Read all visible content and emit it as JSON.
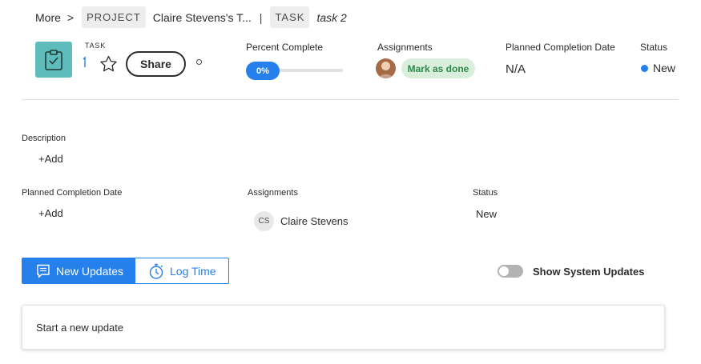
{
  "breadcrumb": {
    "more_label": "More",
    "separator": ">",
    "project_chip": "PROJECT",
    "project_name": "Claire Stevens's T...",
    "pipe": "|",
    "task_chip": "TASK",
    "task_name": "task 2"
  },
  "header": {
    "object_type": "TASK",
    "task_icon": "clipboard-icon",
    "favorite_icon": "star-icon",
    "share_label": "Share",
    "more_icon": "circle-icon"
  },
  "fields": {
    "percent_complete": {
      "label": "Percent Complete",
      "value": "0%",
      "fraction": 0
    },
    "assignments": {
      "label": "Assignments",
      "mark_done_label": "Mark as done"
    },
    "planned_completion": {
      "label": "Planned Completion Date",
      "value": "N/A"
    },
    "status": {
      "label": "Status",
      "value": "New",
      "color": "#2680eb"
    }
  },
  "details": {
    "description_label": "Description",
    "description_add": "+Add",
    "planned_completion_label": "Planned Completion Date",
    "planned_completion_add": "+Add",
    "assignments_label": "Assignments",
    "assignee_initials": "CS",
    "assignee_name": "Claire Stevens",
    "status_label": "Status",
    "status_value": "New"
  },
  "tabs": [
    {
      "label": "New Updates",
      "icon": "comment-icon",
      "active": true
    },
    {
      "label": "Log Time",
      "icon": "stopwatch-icon",
      "active": false
    }
  ],
  "system_updates": {
    "label": "Show System Updates",
    "enabled": false
  },
  "update_box": {
    "placeholder": "Start a new update"
  },
  "colors": {
    "accent": "#2680eb",
    "task_icon_bg": "#5ebdba",
    "mark_done_bg": "#d9efdc",
    "mark_done_text": "#2d8a4a"
  }
}
